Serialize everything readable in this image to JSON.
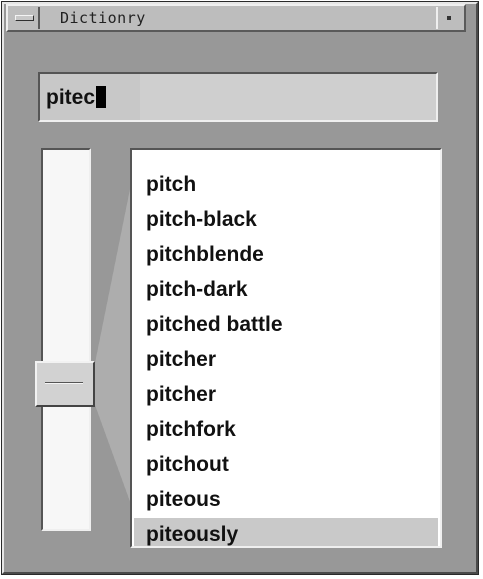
{
  "window": {
    "title": "Dictionry"
  },
  "search": {
    "value": "pitec"
  },
  "results": {
    "items": [
      {
        "label": "pitch",
        "selected": false
      },
      {
        "label": "pitch-black",
        "selected": false
      },
      {
        "label": "pitchblende",
        "selected": false
      },
      {
        "label": "pitch-dark",
        "selected": false
      },
      {
        "label": "pitched battle",
        "selected": false
      },
      {
        "label": "pitcher",
        "selected": false
      },
      {
        "label": "pitcher",
        "selected": false
      },
      {
        "label": "pitchfork",
        "selected": false
      },
      {
        "label": "pitchout",
        "selected": false
      },
      {
        "label": "piteous",
        "selected": false
      },
      {
        "label": "piteously",
        "selected": true
      }
    ]
  }
}
